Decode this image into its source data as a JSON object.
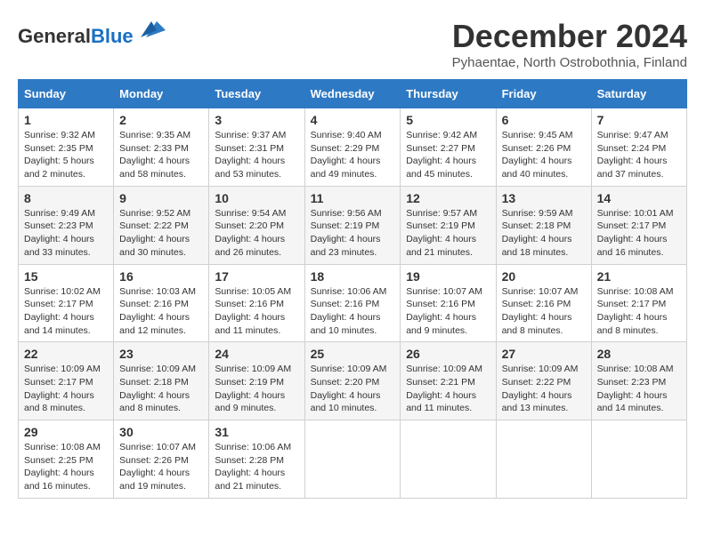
{
  "logo": {
    "general": "General",
    "blue": "Blue"
  },
  "title": "December 2024",
  "subtitle": "Pyhaentae, North Ostrobothnia, Finland",
  "days_of_week": [
    "Sunday",
    "Monday",
    "Tuesday",
    "Wednesday",
    "Thursday",
    "Friday",
    "Saturday"
  ],
  "weeks": [
    [
      {
        "day": "1",
        "sunrise": "Sunrise: 9:32 AM",
        "sunset": "Sunset: 2:35 PM",
        "daylight": "Daylight: 5 hours and 2 minutes."
      },
      {
        "day": "2",
        "sunrise": "Sunrise: 9:35 AM",
        "sunset": "Sunset: 2:33 PM",
        "daylight": "Daylight: 4 hours and 58 minutes."
      },
      {
        "day": "3",
        "sunrise": "Sunrise: 9:37 AM",
        "sunset": "Sunset: 2:31 PM",
        "daylight": "Daylight: 4 hours and 53 minutes."
      },
      {
        "day": "4",
        "sunrise": "Sunrise: 9:40 AM",
        "sunset": "Sunset: 2:29 PM",
        "daylight": "Daylight: 4 hours and 49 minutes."
      },
      {
        "day": "5",
        "sunrise": "Sunrise: 9:42 AM",
        "sunset": "Sunset: 2:27 PM",
        "daylight": "Daylight: 4 hours and 45 minutes."
      },
      {
        "day": "6",
        "sunrise": "Sunrise: 9:45 AM",
        "sunset": "Sunset: 2:26 PM",
        "daylight": "Daylight: 4 hours and 40 minutes."
      },
      {
        "day": "7",
        "sunrise": "Sunrise: 9:47 AM",
        "sunset": "Sunset: 2:24 PM",
        "daylight": "Daylight: 4 hours and 37 minutes."
      }
    ],
    [
      {
        "day": "8",
        "sunrise": "Sunrise: 9:49 AM",
        "sunset": "Sunset: 2:23 PM",
        "daylight": "Daylight: 4 hours and 33 minutes."
      },
      {
        "day": "9",
        "sunrise": "Sunrise: 9:52 AM",
        "sunset": "Sunset: 2:22 PM",
        "daylight": "Daylight: 4 hours and 30 minutes."
      },
      {
        "day": "10",
        "sunrise": "Sunrise: 9:54 AM",
        "sunset": "Sunset: 2:20 PM",
        "daylight": "Daylight: 4 hours and 26 minutes."
      },
      {
        "day": "11",
        "sunrise": "Sunrise: 9:56 AM",
        "sunset": "Sunset: 2:19 PM",
        "daylight": "Daylight: 4 hours and 23 minutes."
      },
      {
        "day": "12",
        "sunrise": "Sunrise: 9:57 AM",
        "sunset": "Sunset: 2:19 PM",
        "daylight": "Daylight: 4 hours and 21 minutes."
      },
      {
        "day": "13",
        "sunrise": "Sunrise: 9:59 AM",
        "sunset": "Sunset: 2:18 PM",
        "daylight": "Daylight: 4 hours and 18 minutes."
      },
      {
        "day": "14",
        "sunrise": "Sunrise: 10:01 AM",
        "sunset": "Sunset: 2:17 PM",
        "daylight": "Daylight: 4 hours and 16 minutes."
      }
    ],
    [
      {
        "day": "15",
        "sunrise": "Sunrise: 10:02 AM",
        "sunset": "Sunset: 2:17 PM",
        "daylight": "Daylight: 4 hours and 14 minutes."
      },
      {
        "day": "16",
        "sunrise": "Sunrise: 10:03 AM",
        "sunset": "Sunset: 2:16 PM",
        "daylight": "Daylight: 4 hours and 12 minutes."
      },
      {
        "day": "17",
        "sunrise": "Sunrise: 10:05 AM",
        "sunset": "Sunset: 2:16 PM",
        "daylight": "Daylight: 4 hours and 11 minutes."
      },
      {
        "day": "18",
        "sunrise": "Sunrise: 10:06 AM",
        "sunset": "Sunset: 2:16 PM",
        "daylight": "Daylight: 4 hours and 10 minutes."
      },
      {
        "day": "19",
        "sunrise": "Sunrise: 10:07 AM",
        "sunset": "Sunset: 2:16 PM",
        "daylight": "Daylight: 4 hours and 9 minutes."
      },
      {
        "day": "20",
        "sunrise": "Sunrise: 10:07 AM",
        "sunset": "Sunset: 2:16 PM",
        "daylight": "Daylight: 4 hours and 8 minutes."
      },
      {
        "day": "21",
        "sunrise": "Sunrise: 10:08 AM",
        "sunset": "Sunset: 2:17 PM",
        "daylight": "Daylight: 4 hours and 8 minutes."
      }
    ],
    [
      {
        "day": "22",
        "sunrise": "Sunrise: 10:09 AM",
        "sunset": "Sunset: 2:17 PM",
        "daylight": "Daylight: 4 hours and 8 minutes."
      },
      {
        "day": "23",
        "sunrise": "Sunrise: 10:09 AM",
        "sunset": "Sunset: 2:18 PM",
        "daylight": "Daylight: 4 hours and 8 minutes."
      },
      {
        "day": "24",
        "sunrise": "Sunrise: 10:09 AM",
        "sunset": "Sunset: 2:19 PM",
        "daylight": "Daylight: 4 hours and 9 minutes."
      },
      {
        "day": "25",
        "sunrise": "Sunrise: 10:09 AM",
        "sunset": "Sunset: 2:20 PM",
        "daylight": "Daylight: 4 hours and 10 minutes."
      },
      {
        "day": "26",
        "sunrise": "Sunrise: 10:09 AM",
        "sunset": "Sunset: 2:21 PM",
        "daylight": "Daylight: 4 hours and 11 minutes."
      },
      {
        "day": "27",
        "sunrise": "Sunrise: 10:09 AM",
        "sunset": "Sunset: 2:22 PM",
        "daylight": "Daylight: 4 hours and 13 minutes."
      },
      {
        "day": "28",
        "sunrise": "Sunrise: 10:08 AM",
        "sunset": "Sunset: 2:23 PM",
        "daylight": "Daylight: 4 hours and 14 minutes."
      }
    ],
    [
      {
        "day": "29",
        "sunrise": "Sunrise: 10:08 AM",
        "sunset": "Sunset: 2:25 PM",
        "daylight": "Daylight: 4 hours and 16 minutes."
      },
      {
        "day": "30",
        "sunrise": "Sunrise: 10:07 AM",
        "sunset": "Sunset: 2:26 PM",
        "daylight": "Daylight: 4 hours and 19 minutes."
      },
      {
        "day": "31",
        "sunrise": "Sunrise: 10:06 AM",
        "sunset": "Sunset: 2:28 PM",
        "daylight": "Daylight: 4 hours and 21 minutes."
      },
      null,
      null,
      null,
      null
    ]
  ]
}
